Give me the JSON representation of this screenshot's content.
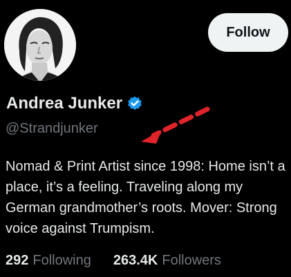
{
  "profile": {
    "display_name": "Andrea Junker",
    "handle": "@Strandjunker",
    "bio": "Nomad & Print Artist since 1998: Home isn’t a place, it’s a feeling. Traveling along my German grandmother’s roots. Mover: Strong voice against Trumpism.",
    "verified_icon": "verified-badge-icon",
    "avatar_icon": "profile-photo"
  },
  "actions": {
    "follow_label": "Follow"
  },
  "stats": {
    "following_count": "292",
    "following_label": "Following",
    "followers_count": "263.4K",
    "followers_label": "Followers"
  },
  "colors": {
    "background": "#000000",
    "text_primary": "#e7e9ea",
    "text_secondary": "#71767b",
    "verified_blue": "#1d9bf0",
    "annotation_red": "#e0242a",
    "button_bg": "#eff3f4"
  }
}
